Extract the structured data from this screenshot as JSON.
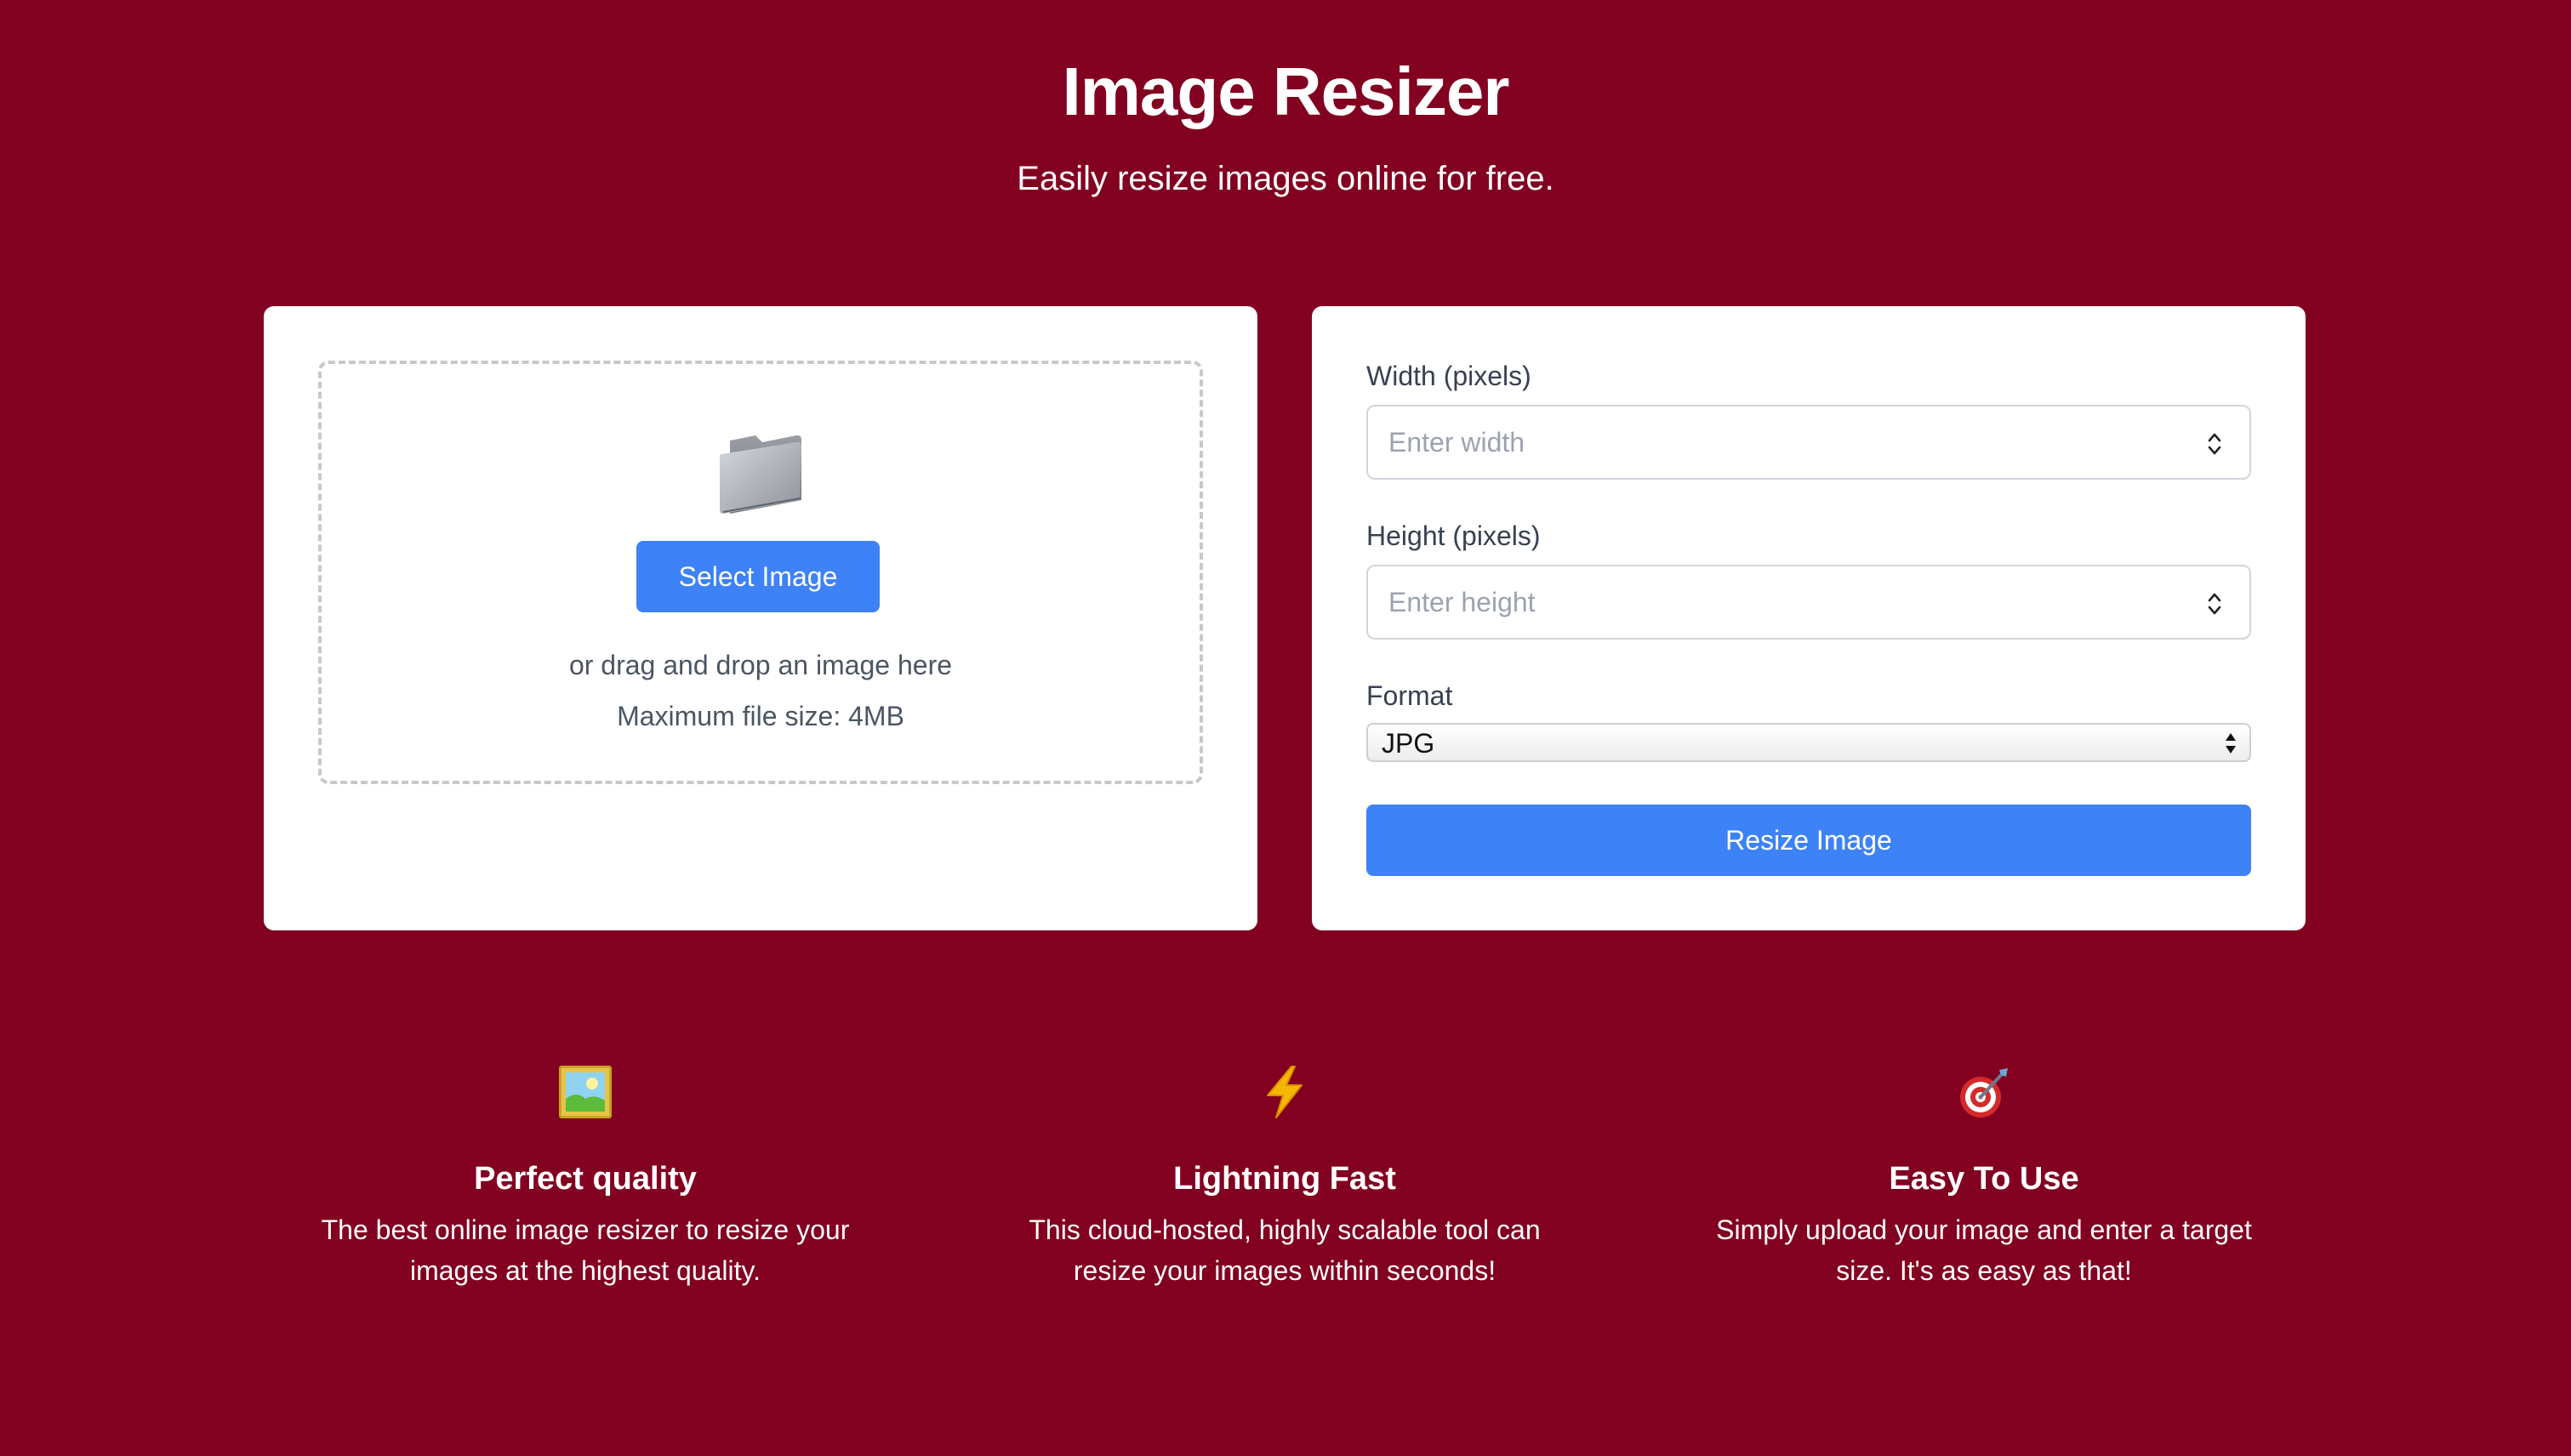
{
  "header": {
    "title": "Image Resizer",
    "subtitle": "Easily resize images online for free."
  },
  "upload": {
    "icon": "folder-icon",
    "select_label": "Select Image",
    "drag_hint": "or drag and drop an image here",
    "size_hint": "Maximum file size: 4MB"
  },
  "settings": {
    "width_label": "Width (pixels)",
    "width_placeholder": "Enter width",
    "height_label": "Height (pixels)",
    "height_placeholder": "Enter height",
    "format_label": "Format",
    "format_value": "JPG",
    "resize_label": "Resize Image"
  },
  "features": [
    {
      "icon": "framed-picture-icon",
      "title": "Perfect quality",
      "line1": "The best online image resizer to resize your",
      "line2": "images at the highest quality."
    },
    {
      "icon": "lightning-icon",
      "title": "Lightning Fast",
      "line1": "This cloud-hosted, highly scalable tool can",
      "line2": "resize your images within seconds!"
    },
    {
      "icon": "target-icon",
      "title": "Easy To Use",
      "line1": "Simply upload your image and enter a target",
      "line2": "size. It's as easy as that!"
    }
  ],
  "colors": {
    "background": "#820020",
    "accent": "#3d82f6",
    "card": "#ffffff"
  }
}
